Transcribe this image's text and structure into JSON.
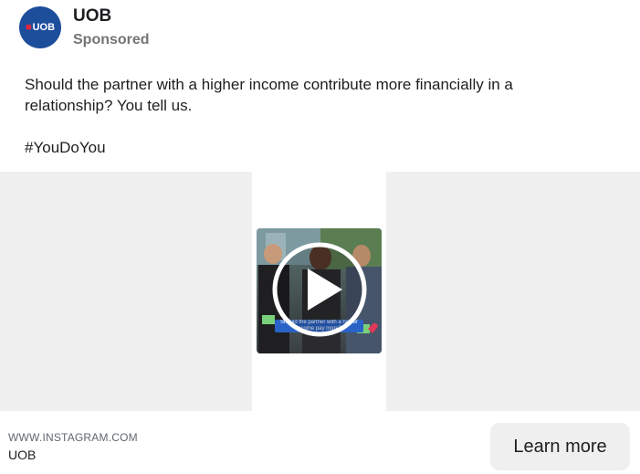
{
  "post": {
    "page_name": "UOB",
    "sponsored_label": "Sponsored",
    "avatar": {
      "text": "UOB",
      "brand_color": "#1d4e9c",
      "accent_color": "#e4253c",
      "icon": "uob-logo-icon"
    }
  },
  "caption": {
    "text": "Should the partner with a higher income contribute more financially in a relationship? You tell us.",
    "hashtag": "#YouDoYou"
  },
  "media": {
    "type": "video",
    "overlay_text": "Should the partner with a higher income pay more?",
    "play_icon": "play-icon"
  },
  "footer": {
    "domain": "WWW.INSTAGRAM.COM",
    "title": "UOB",
    "cta_label": "Learn more"
  }
}
